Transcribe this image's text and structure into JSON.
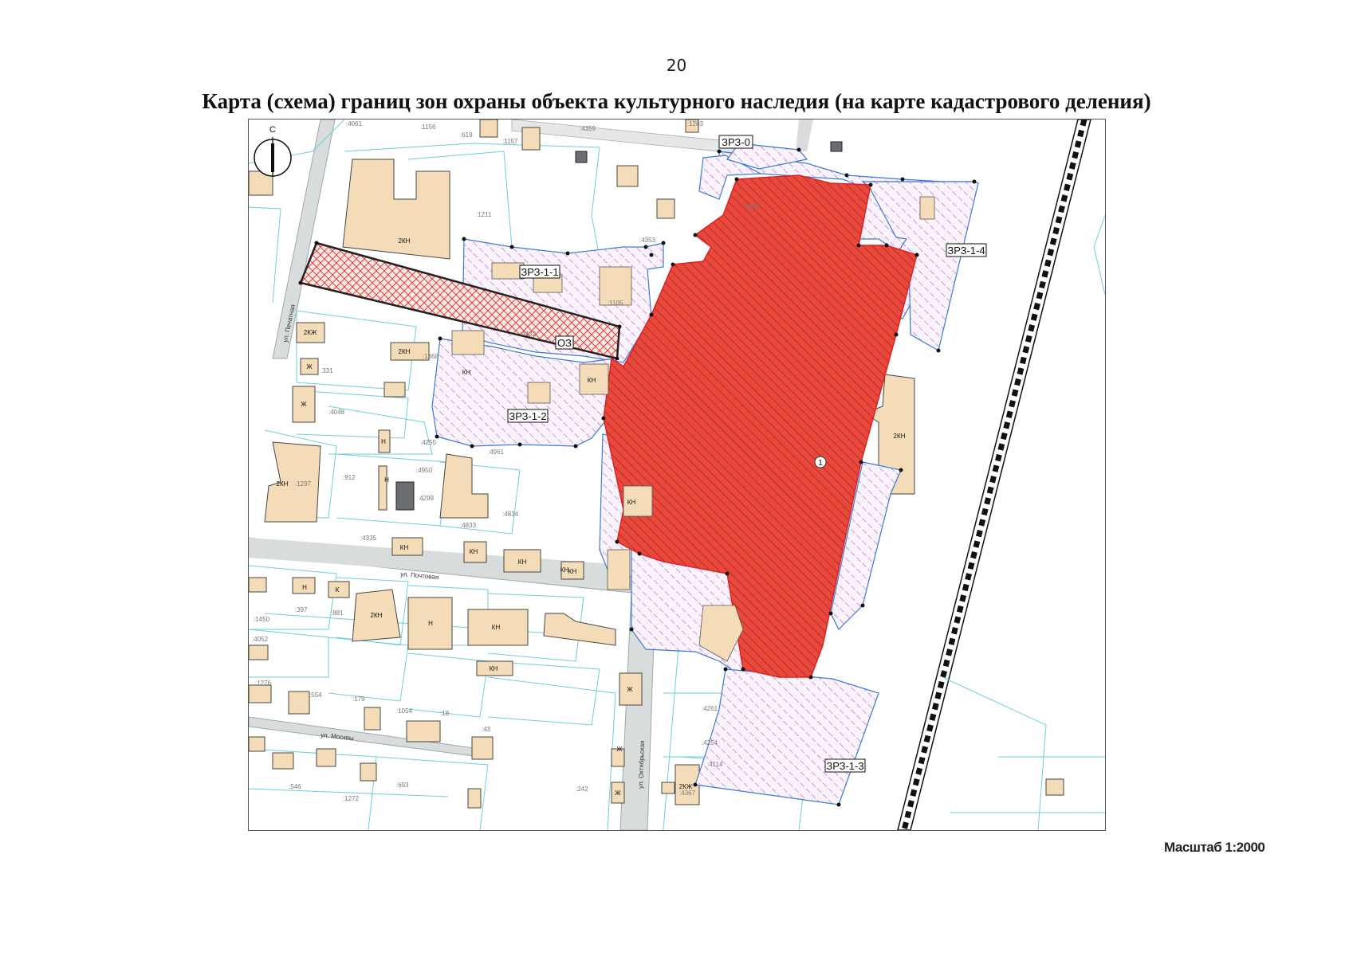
{
  "page": {
    "number": "20",
    "title": "Карта (схема) границ зон охраны объекта культурного наследия (на карте кадастрового деления)",
    "scale": "Масштаб 1:2000"
  },
  "compass": {
    "north_letter": "С"
  },
  "zones": {
    "zrz0": "ЗРЗ-0",
    "zrz11": "ЗРЗ-1-1",
    "zrz12": "ЗРЗ-1-2",
    "zrz13": "ЗРЗ-1-3",
    "zrz14": "ЗРЗ-1-4",
    "oz": "ОЗ",
    "object_number": "1"
  },
  "streets": {
    "pechatnaya_left": "ул. Печатная",
    "pochtovaya": "ул. Почтовая",
    "moskvy": "ул. Москвы",
    "oktyabrskaya": "ул. Октябрьская"
  },
  "buildings": {
    "b1": "2КН",
    "b2": "2КЖ",
    "b3": "2КН",
    "b4": "Ж",
    "b5": "Ж",
    "b6": "2КН",
    "b7": "КН",
    "b8": "КН",
    "b9": "2КН",
    "b10": "КН",
    "b11": "Н",
    "b12": "КН",
    "b13": "КН",
    "b14": "КН",
    "b15": "Н",
    "b16": "К",
    "b17": "2КН",
    "b18": "Н",
    "b19": "КН",
    "b20": "КН",
    "b21": "КН",
    "b22": "Ж",
    "b23": "Ж",
    "b24": "Ж",
    "b25": "2КЖ",
    "b26": "КН",
    "b27": "Н"
  },
  "parcels": {
    "p1": ":4061",
    "p2": ":1156",
    "p3": ":619",
    "p4": ":1157",
    "p5": ":4359",
    "p6": ":1211",
    "p7": ":4353",
    "p8": ":1368",
    "p9": ":331",
    "p10": ":4048",
    "p11": ":4255",
    "p12": ":4950",
    "p13": ":4299",
    "p14": ":4335",
    "p15": ":912",
    "p16": ":1297",
    "p17": ":4961",
    "p18": ":1450",
    "p19": ":397",
    "p20": ":881",
    "p21": ":4052",
    "p22": ":1276",
    "p23": ":554",
    "p24": ":179",
    "p25": ":1054",
    "p26": ":18",
    "p27": ":43",
    "p28": ":546",
    "p29": ":1272",
    "p30": ":693",
    "p31": ":242",
    "p32": ":4261",
    "p33": ":4254",
    "p34": ":4114",
    "p35": ":4367",
    "p36": ":3646",
    "p37": ":4432",
    "p38": ":4834",
    "p39": ":1263",
    "p40": ":4833",
    "p41": ":1105"
  }
}
